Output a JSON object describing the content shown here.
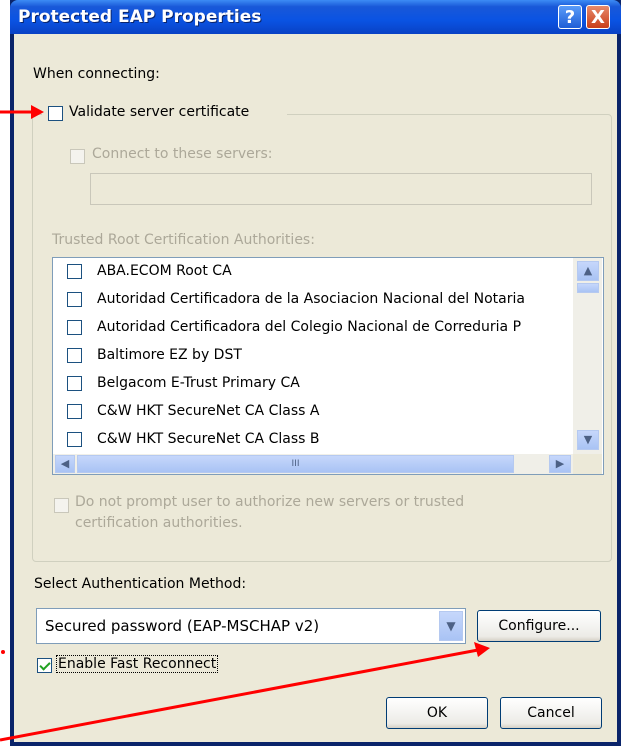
{
  "window": {
    "title": "Protected EAP Properties",
    "help_label": "?",
    "close_label": "X"
  },
  "when_connecting_label": "When connecting:",
  "validate_server_certificate": {
    "label": "Validate server certificate",
    "checked": false
  },
  "connect_to_servers": {
    "label": "Connect to these servers:",
    "checked": false,
    "value": ""
  },
  "trusted_root_label": "Trusted Root Certification Authorities:",
  "trusted_roots": [
    "ABA.ECOM Root CA",
    "Autoridad Certificadora de la Asociacion Nacional del Notaria",
    "Autoridad Certificadora del Colegio Nacional de Correduria P",
    "Baltimore EZ by DST",
    "Belgacom E-Trust Primary CA",
    "C&W HKT SecureNet CA Class A",
    "C&W HKT SecureNet CA Class B"
  ],
  "scroll": {
    "up": "▲",
    "down": "▼",
    "left": "◀",
    "right": "▶",
    "grip": "III"
  },
  "do_not_prompt": {
    "line1": "Do not prompt user to authorize new servers or trusted",
    "line2": "certification authorities.",
    "checked": false
  },
  "auth_method_label": "Select Authentication Method:",
  "auth_method_value": "Secured password (EAP-MSCHAP v2)",
  "configure_label": "Configure...",
  "fast_reconnect": {
    "label": "Enable Fast Reconnect",
    "checked": true
  },
  "ok_label": "OK",
  "cancel_label": "Cancel",
  "colors": {
    "titlebar": "#0a53e3",
    "client": "#ece9d8",
    "annotation": "#ff0000"
  }
}
